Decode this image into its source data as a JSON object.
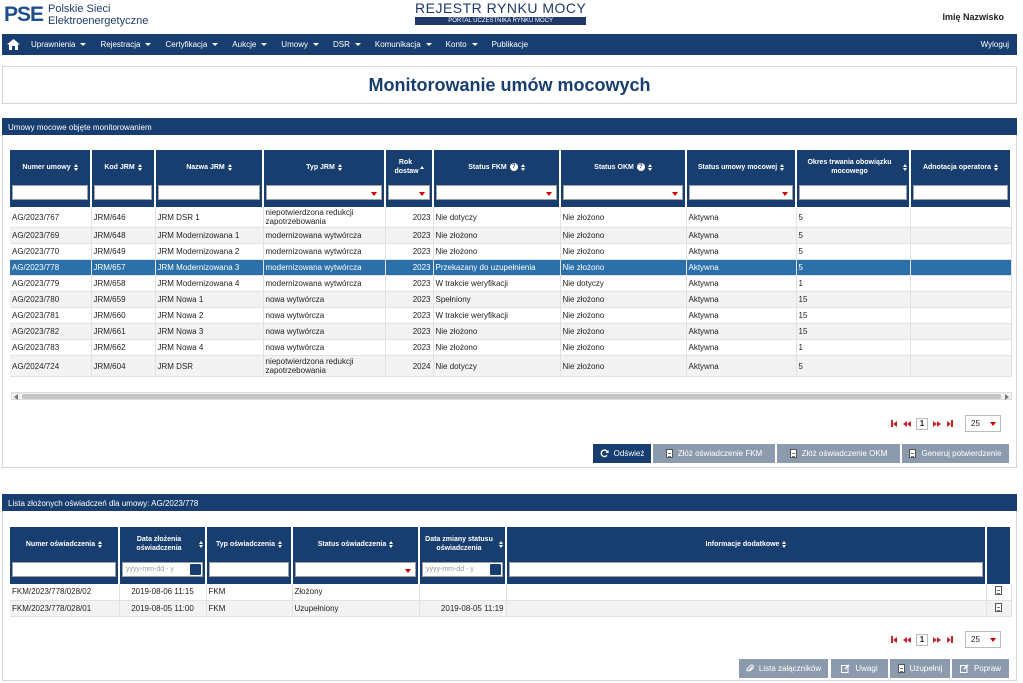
{
  "header": {
    "logo_mark": "PSE",
    "logo_line1": "Polskie Sieci",
    "logo_line2": "Elektroenergetyczne",
    "registry_title": "REJESTR RYNKU MOCY",
    "registry_subtitle": "PORTAL UCZESTNIKA RYNKU MOCY",
    "user_name": "Imię Nazwisko"
  },
  "nav": {
    "items": [
      "Uprawnienia",
      "Rejestracja",
      "Certyfikacja",
      "Aukcje",
      "Umowy",
      "DSR",
      "Komunikacja",
      "Konto",
      "Publikacje"
    ],
    "logout": "Wyloguj"
  },
  "page_title": "Monitorowanie umów mocowych",
  "contracts": {
    "panel_title": "Umowy mocowe objęte monitorowaniem",
    "columns": [
      "Numer umowy",
      "Kod JRM",
      "Nazwa JRM",
      "Typ JRM",
      "Rok dostaw",
      "Status FKM",
      "Status OKM",
      "Status umowy mocowej",
      "Okres trwania obowiązku mocowego",
      "Adnotacja operatora"
    ],
    "rows": [
      [
        "AG/2023/767",
        "JRM/646",
        "JRM DSR 1",
        "niepotwierdzona redukcji zapotrzebowania",
        "2023",
        "Nie dotyczy",
        "Nie złożono",
        "Aktywna",
        "5",
        ""
      ],
      [
        "AG/2023/769",
        "JRM/648",
        "JRM Modernizowana 1",
        "modernizowana wytwórcza",
        "2023",
        "Nie złożono",
        "Nie złożono",
        "Aktywna",
        "5",
        ""
      ],
      [
        "AG/2023/770",
        "JRM/649",
        "JRM Modernizowana 2",
        "modernizowana wytwórcza",
        "2023",
        "Nie złożono",
        "Nie złożono",
        "Aktywna",
        "5",
        ""
      ],
      [
        "AG/2023/778",
        "JRM/657",
        "JRM Modernizowana 3",
        "modernizowana wytwórcza",
        "2023",
        "Przekazany do uzupełnienia",
        "Nie złożono",
        "Aktywna",
        "5",
        ""
      ],
      [
        "AG/2023/779",
        "JRM/658",
        "JRM Modernizowana 4",
        "modernizowana wytwórcza",
        "2023",
        "W trakcie weryfikacji",
        "Nie dotyczy",
        "Aktywna",
        "1",
        ""
      ],
      [
        "AG/2023/780",
        "JRM/659",
        "JRM Nowa 1",
        "nowa wytwórcza",
        "2023",
        "Spełniony",
        "Nie złożono",
        "Aktywna",
        "15",
        ""
      ],
      [
        "AG/2023/781",
        "JRM/660",
        "JRM Nowa 2",
        "nowa wytwórcza",
        "2023",
        "W trakcie weryfikacji",
        "Nie złożono",
        "Aktywna",
        "15",
        ""
      ],
      [
        "AG/2023/782",
        "JRM/661",
        "JRM Nowa 3",
        "nowa wytwórcza",
        "2023",
        "Nie złożono",
        "Nie złożono",
        "Aktywna",
        "15",
        ""
      ],
      [
        "AG/2023/783",
        "JRM/662",
        "JRM Nowa 4",
        "nowa wytwórcza",
        "2023",
        "Nie złożono",
        "Nie złożono",
        "Aktywna",
        "1",
        ""
      ],
      [
        "AG/2024/724",
        "JRM/604",
        "JRM DSR",
        "niepotwierdzona redukcji zapotrzebowania",
        "2024",
        "Nie dotyczy",
        "Nie złożono",
        "Aktywna",
        "5",
        ""
      ]
    ],
    "selected_row": 3,
    "page": "1",
    "page_size": "25",
    "buttons": {
      "refresh": "Odśwież",
      "submit_fkm": "Złóż oświadczenie FKM",
      "submit_okm": "Złóż oświadczenie OKM",
      "generate": "Generuj potwierdzenie"
    }
  },
  "statements": {
    "panel_title": "Lista złożonych oświadczeń dla umowy: AG/2023/778",
    "columns": [
      "Numer oświadczenia",
      "Data złożenia oświadczenia",
      "Typ oświadczenia",
      "Status oświadczenia",
      "Data zmiany statusu oświadczenia",
      "Informacje dodatkowe"
    ],
    "date_placeholder": "yyyy-mm-dd - y",
    "rows": [
      [
        "FKM/2023/778/028/02",
        "2019-08-06 11:15",
        "FKM",
        "Złożony",
        "",
        ""
      ],
      [
        "FKM/2023/778/028/01",
        "2019-08-05 11:00",
        "FKM",
        "Uzupełniony",
        "2019-08-05 11:19",
        ""
      ]
    ],
    "page": "1",
    "page_size": "25",
    "buttons": {
      "attachments": "Lista załączników",
      "remarks": "Uwagi",
      "complete": "Uzupełnij",
      "correct": "Popraw"
    }
  }
}
